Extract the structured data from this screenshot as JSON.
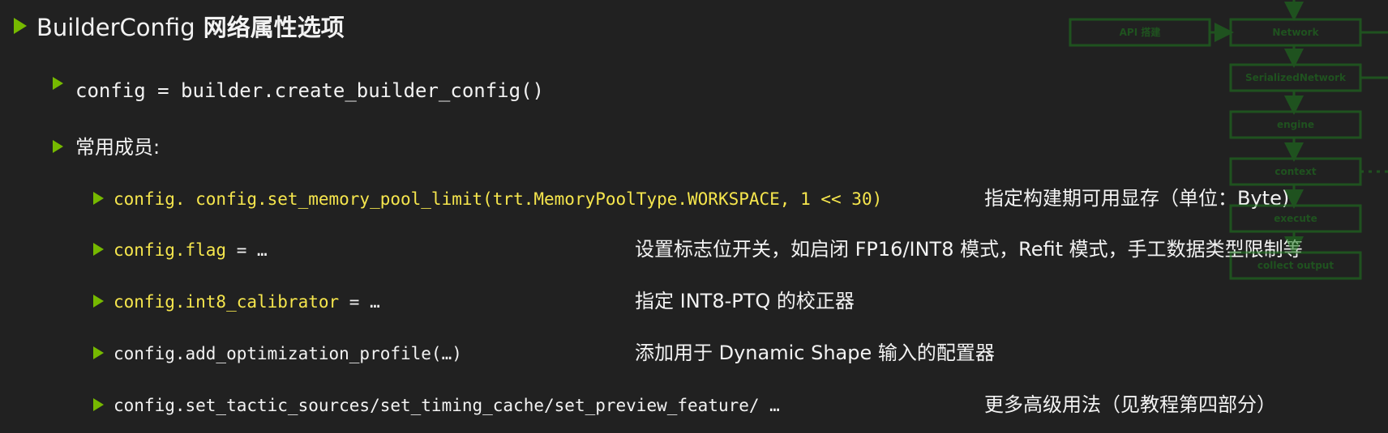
{
  "title": {
    "prefix": "BuilderConfig",
    "suffix": " 网络属性选项"
  },
  "level2": {
    "create_line": "config = builder.create_builder_config()",
    "members_label": "常用成员:"
  },
  "members": [
    {
      "code_highlight": "config. config.set_memory_pool_limit(trt.MemoryPoolType.WORKSPACE, 1 << 30)",
      "code_rest": "",
      "description": "指定构建期可用显存（单位：Byte)"
    },
    {
      "code_highlight": "config.flag",
      "code_rest": " = …",
      "description": "设置标志位开关，如启闭 FP16/INT8 模式，Refit 模式，手工数据类型限制等"
    },
    {
      "code_highlight": "config.int8_calibrator",
      "code_rest": " = …",
      "description": "指定 INT8-PTQ 的校正器"
    },
    {
      "code_highlight": "",
      "code_rest": "config.add_optimization_profile(…)",
      "description": "添加用于 Dynamic Shape 输入的配置器"
    },
    {
      "code_highlight": "",
      "code_rest": "config.set_tactic_sources/set_timing_cache/set_preview_feature/ …",
      "description": "更多高级用法（见教程第四部分）"
    }
  ],
  "diagram": {
    "boxes": [
      "API 搭建",
      "Network",
      "SerializedNetwork",
      "engine",
      "context",
      "execute",
      "collect output"
    ]
  },
  "colors": {
    "background": "#212121",
    "accent": "#76b900",
    "code_yellow": "#f6e64d",
    "text": "#f2f2f2"
  },
  "icons": {
    "bullet": "triangle-arrow-icon"
  }
}
